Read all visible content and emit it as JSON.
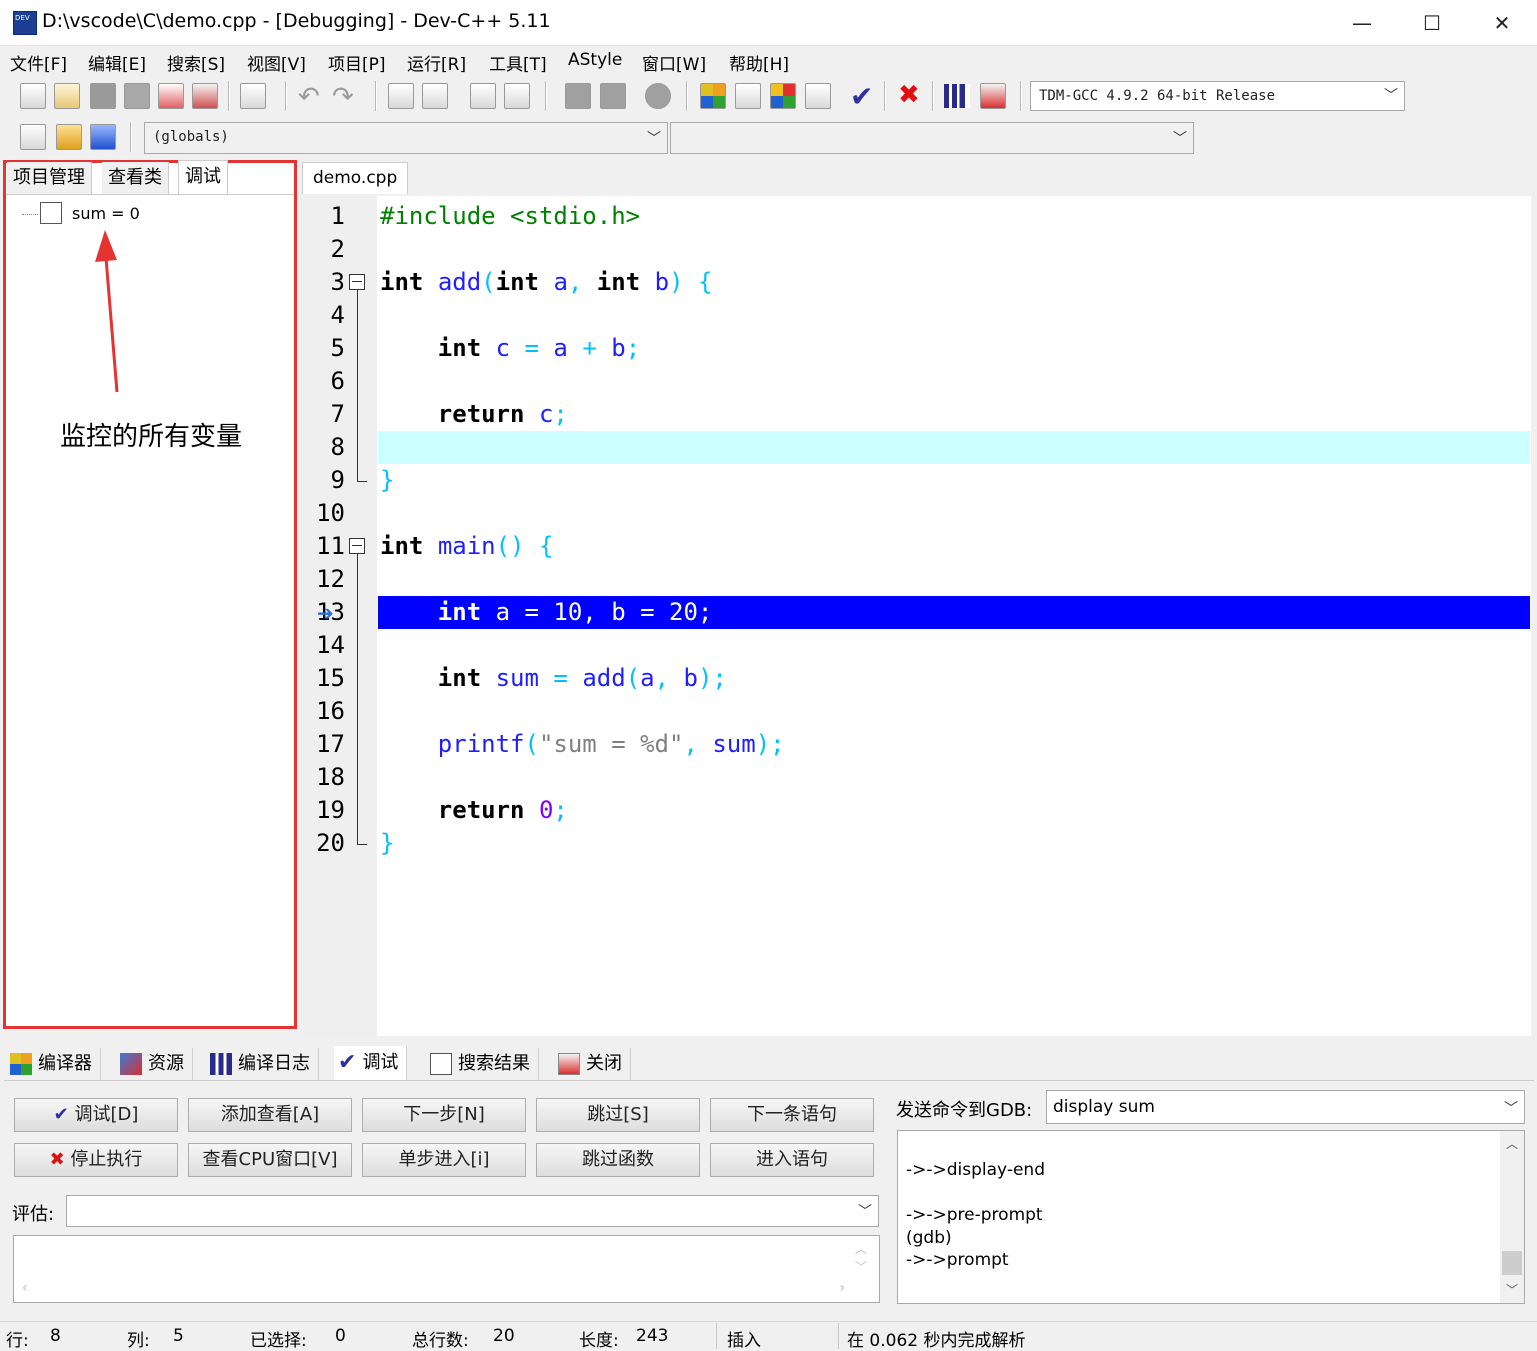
{
  "window": {
    "title": "D:\\vscode\\C\\demo.cpp - [Debugging] - Dev-C++ 5.11",
    "icon_label": "DEV",
    "minimize": "—",
    "maximize": "☐",
    "close": "✕"
  },
  "menu": [
    "文件[F]",
    "编辑[E]",
    "搜索[S]",
    "视图[V]",
    "项目[P]",
    "运行[R]",
    "工具[T]",
    "AStyle",
    "窗口[W]",
    "帮助[H]"
  ],
  "toolbar": {
    "compiler_select": "TDM-GCC 4.9.2 64-bit Release",
    "scope_select": "(globals)",
    "function_select": ""
  },
  "left_panel": {
    "tabs": [
      "项目管理",
      "查看类",
      "调试"
    ],
    "active_tab": "调试",
    "watch_items": [
      {
        "label": "sum = 0"
      }
    ],
    "annotation": "监控的所有变量"
  },
  "editor": {
    "tab": "demo.cpp",
    "lines": [
      "1",
      "2",
      "3",
      "4",
      "5",
      "6",
      "7",
      "8",
      "9",
      "10",
      "11",
      "12",
      "13",
      "14",
      "15",
      "16",
      "17",
      "18",
      "19",
      "20"
    ]
  },
  "bottom_tabs": [
    "编译器",
    "资源",
    "编译日志",
    "调试",
    "搜索结果",
    "关闭"
  ],
  "debug": {
    "buttons_row1": [
      "调试[D]",
      "添加查看[A]",
      "下一步[N]",
      "跳过[S]",
      "下一条语句"
    ],
    "buttons_row2": [
      "停止执行",
      "查看CPU窗口[V]",
      "单步进入[i]",
      "跳过函数",
      "进入语句"
    ],
    "eval_label": "评估:",
    "eval_value": "",
    "gdb_label": "发送命令到GDB:",
    "gdb_command": "display sum",
    "gdb_output": [
      "->->display-end",
      "",
      "->->pre-prompt",
      "(gdb)",
      "->->prompt"
    ]
  },
  "status": {
    "row_label": "行:",
    "row": "8",
    "col_label": "列:",
    "col": "5",
    "sel_label": "已选择:",
    "sel": "0",
    "total_label": "总行数:",
    "total": "20",
    "len_label": "长度:",
    "len": "243",
    "mode": "插入",
    "parse_msg": "在 0.062 秒内完成解析"
  },
  "colors": {
    "current_line": "#ccffff",
    "exec_line": "#0000ff",
    "annotation_border": "#e53333",
    "arrow": "#e53333"
  }
}
